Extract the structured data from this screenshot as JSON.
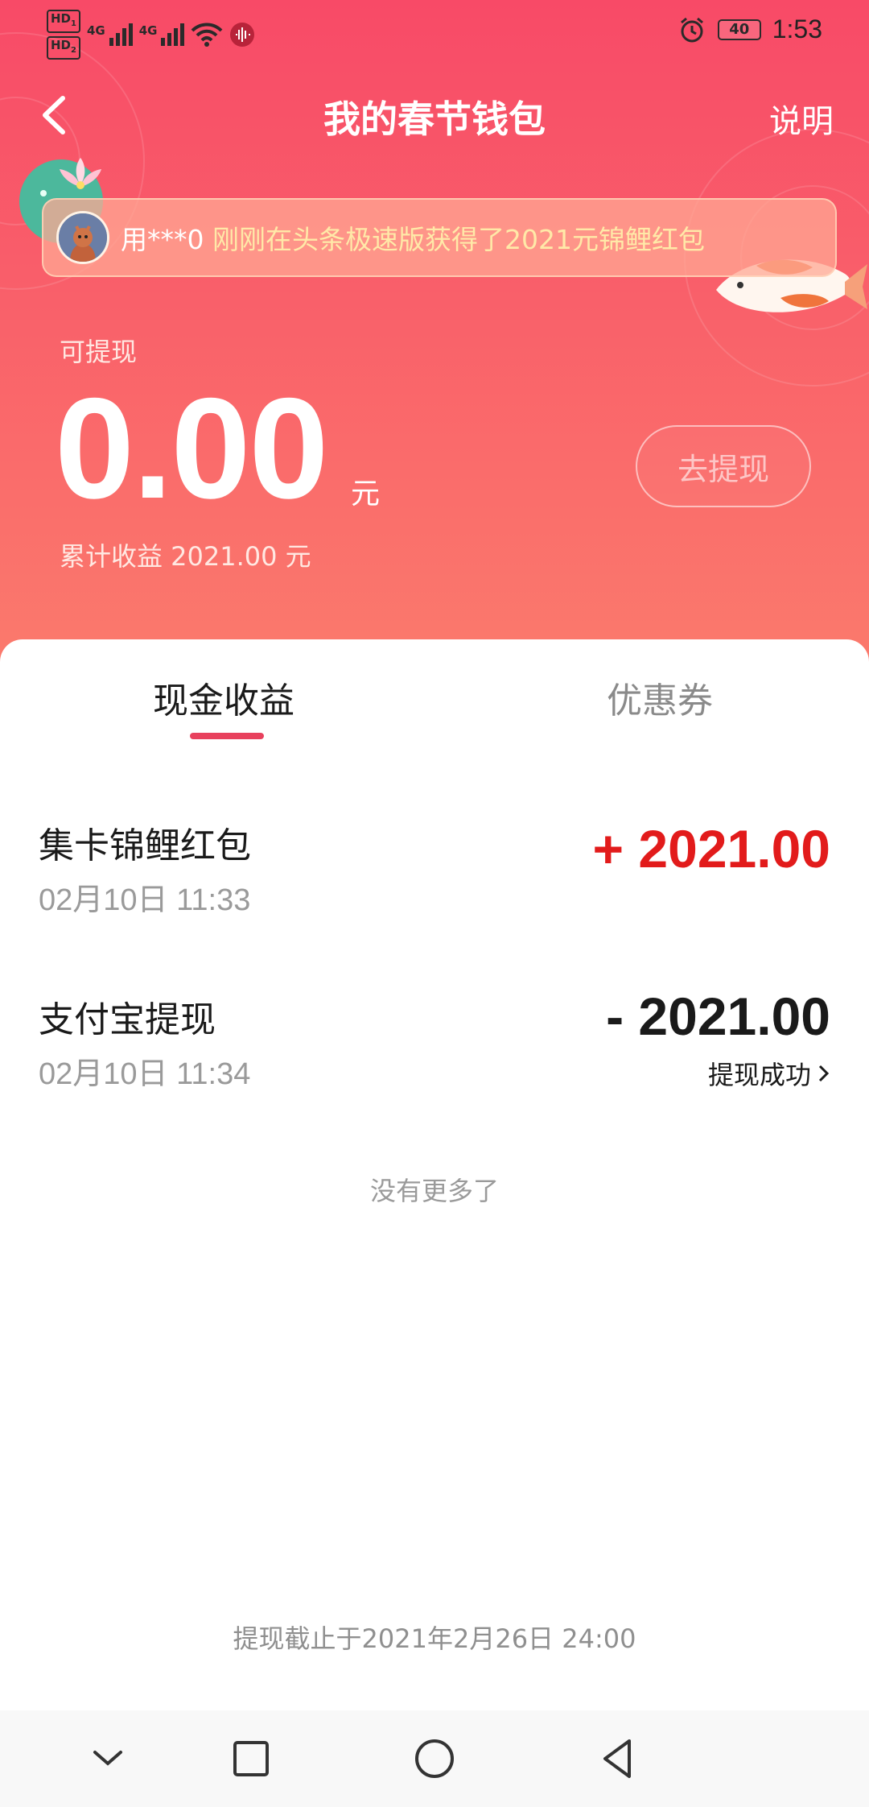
{
  "status_bar": {
    "sim1_label": "HD",
    "sim1_index": "1",
    "sim2_label": "HD",
    "sim2_index": "2",
    "net1_label": "4G",
    "net2_label": "4G",
    "battery_level": "40",
    "time": "1:53"
  },
  "header": {
    "title": "我的春节钱包",
    "help_label": "说明"
  },
  "ticker": {
    "user": "用***0",
    "message": "刚刚在头条极速版获得了2021元锦鲤红包"
  },
  "balance": {
    "label": "可提现",
    "amount": "0.00",
    "unit": "元",
    "total_earnings": "累计收益 2021.00 元",
    "withdraw_button": "去提现"
  },
  "tabs": [
    {
      "label": "现金收益",
      "active": true
    },
    {
      "label": "优惠券",
      "active": false
    }
  ],
  "transactions": [
    {
      "title": "集卡锦鲤红包",
      "time": "02月10日 11:33",
      "amount": "+ 2021.00",
      "status": ""
    },
    {
      "title": "支付宝提现",
      "time": "02月10日 11:34",
      "amount": "- 2021.00",
      "status": "提现成功"
    }
  ],
  "no_more_text": "没有更多了",
  "deadline_text": "提现截止于2021年2月26日 24:00",
  "colors": {
    "header_top": "#f84a67",
    "header_bottom": "#fb7a6c",
    "accent": "#e8415d",
    "income": "#e21b1b",
    "expense": "#1a1a1a"
  }
}
